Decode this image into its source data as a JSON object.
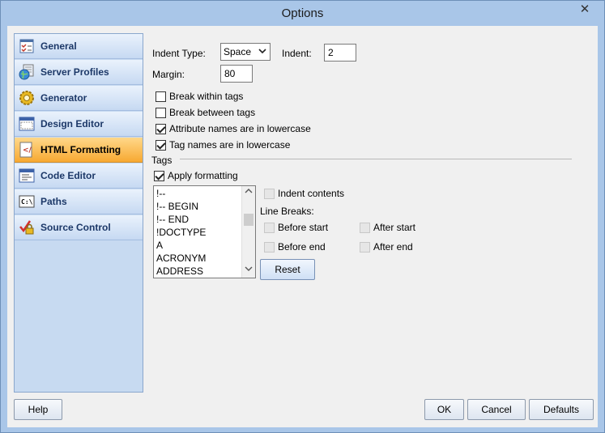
{
  "window": {
    "title": "Options",
    "close_glyph": "✕"
  },
  "sidebar": {
    "items": [
      {
        "label": "General",
        "icon": "checklist-icon",
        "active": false
      },
      {
        "label": "Server Profiles",
        "icon": "globe-icon",
        "active": false
      },
      {
        "label": "Generator",
        "icon": "gear-icon",
        "active": false
      },
      {
        "label": "Design Editor",
        "icon": "window-icon",
        "active": false
      },
      {
        "label": "HTML Formatting",
        "icon": "html-icon",
        "active": true
      },
      {
        "label": "Code Editor",
        "icon": "code-editor-icon",
        "active": false
      },
      {
        "label": "Paths",
        "icon": "terminal-icon",
        "active": false
      },
      {
        "label": "Source Control",
        "icon": "lock-icon",
        "active": false
      }
    ]
  },
  "formatting": {
    "indent_type_label": "Indent Type:",
    "indent_type_value": "Space",
    "indent_label": "Indent:",
    "indent_value": "2",
    "margin_label": "Margin:",
    "margin_value": "80",
    "break_within_tags": "Break within tags",
    "break_between_tags": "Break between tags",
    "attr_lowercase": "Attribute names are in lowercase",
    "tag_lowercase": "Tag names are in lowercase"
  },
  "tags": {
    "group_label": "Tags",
    "apply_formatting": "Apply formatting",
    "list": [
      "!--",
      "!-- BEGIN",
      "!-- END",
      "!DOCTYPE",
      "A",
      "ACRONYM",
      "ADDRESS"
    ],
    "indent_contents": "Indent contents",
    "line_breaks_label": "Line Breaks:",
    "before_start": "Before start",
    "after_start": "After start",
    "before_end": "Before end",
    "after_end": "After end",
    "reset_label": "Reset"
  },
  "footer": {
    "help_label": "Help",
    "ok_label": "OK",
    "cancel_label": "Cancel",
    "defaults_label": "Defaults"
  },
  "colors": {
    "title_bar": "#a9c6e8",
    "sidebar_bg": "#c7daf1",
    "active_item": "#f7a932"
  }
}
